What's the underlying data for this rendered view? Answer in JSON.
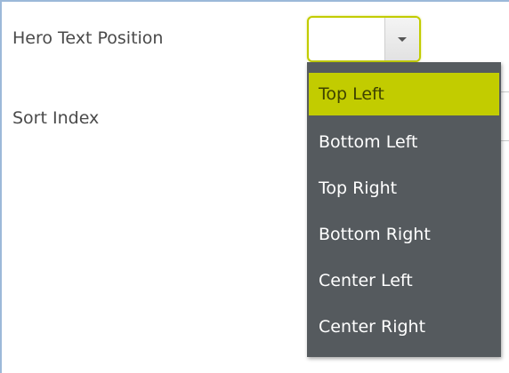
{
  "form": {
    "hero_text_position_label": "Hero Text Position",
    "sort_index_label": "Sort Index"
  },
  "hero_select": {
    "current_value": "",
    "accent_color": "#c2cc00",
    "arrow_icon": "chevron-down-icon",
    "options": [
      {
        "label": "Top Left",
        "highlighted": true
      },
      {
        "label": "Bottom Left",
        "highlighted": false
      },
      {
        "label": "Top Right",
        "highlighted": false
      },
      {
        "label": "Bottom Right",
        "highlighted": false
      },
      {
        "label": "Center Left",
        "highlighted": false
      },
      {
        "label": "Center Right",
        "highlighted": false
      }
    ]
  },
  "colors": {
    "dropdown_background": "#555a5e",
    "highlight": "#c2cc00",
    "frame_border": "#9cb9d9"
  }
}
